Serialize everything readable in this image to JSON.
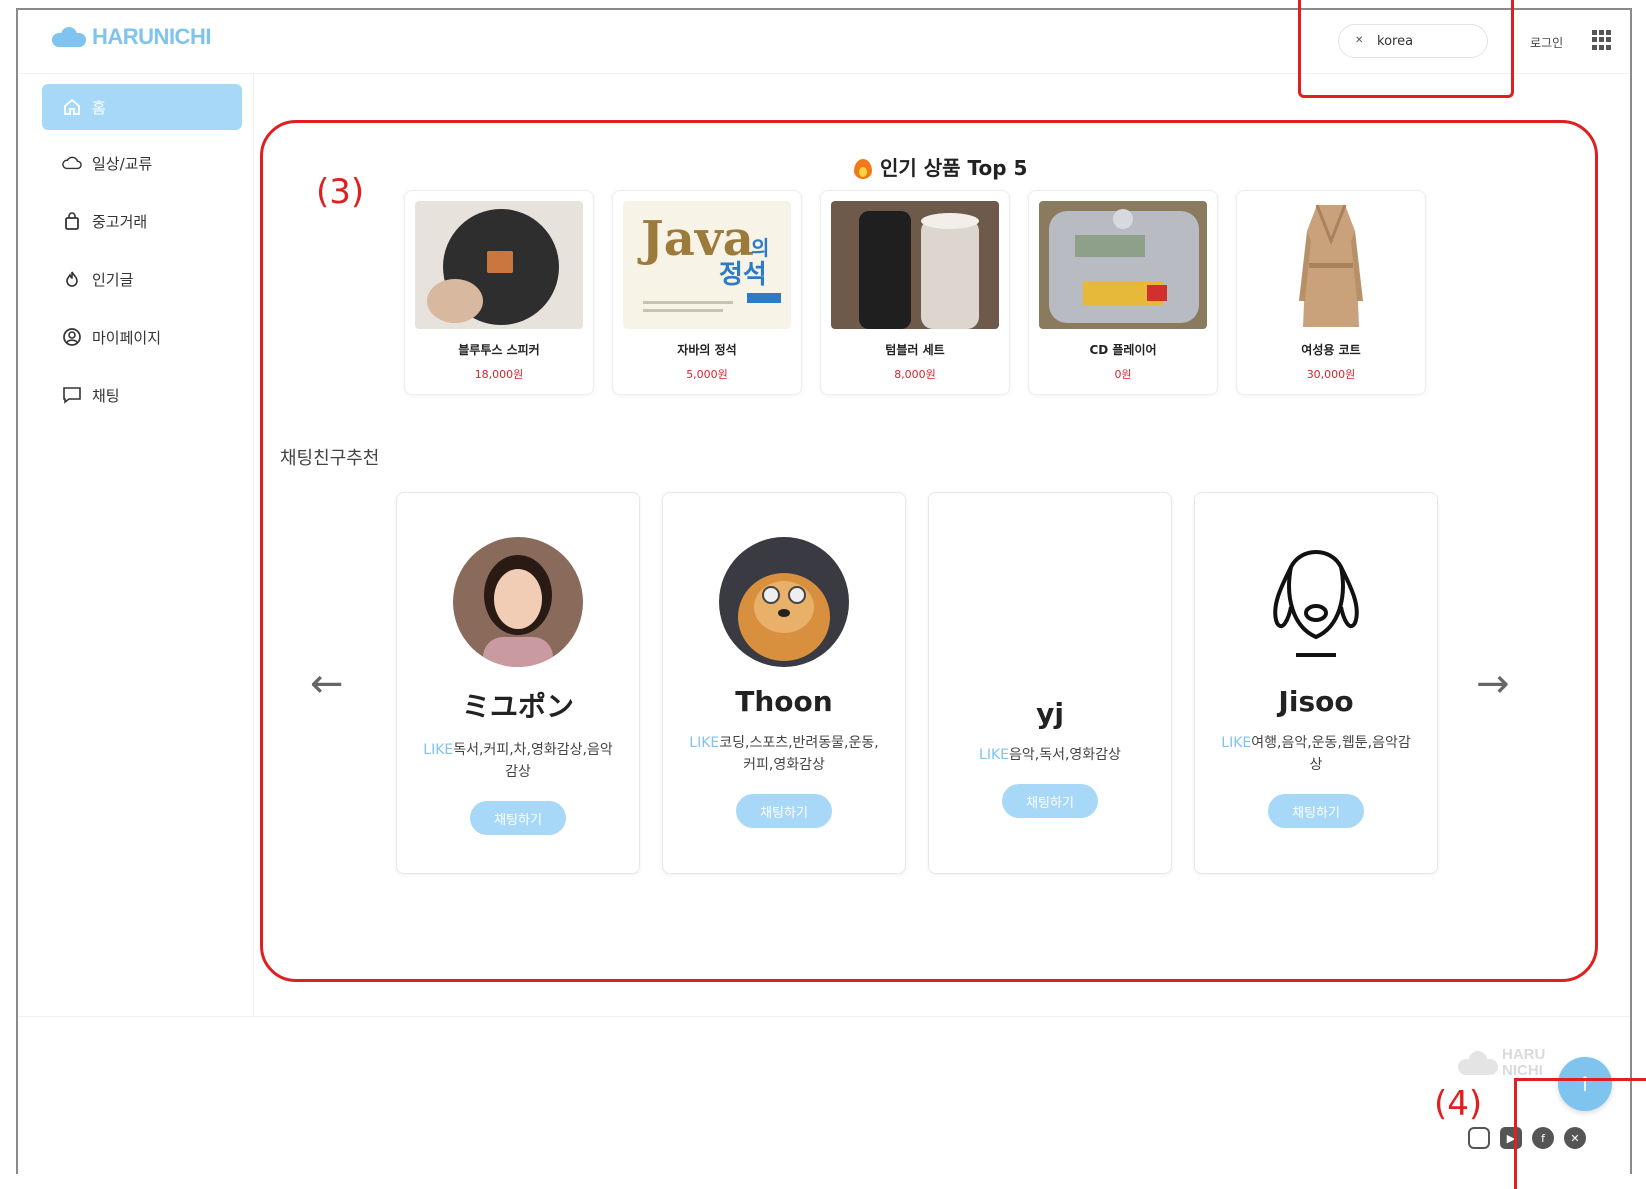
{
  "header": {
    "logo_text": "HARUNICHI",
    "language": "korea",
    "login_label": "로그인"
  },
  "sidebar": {
    "items": [
      {
        "label": "홈",
        "icon": "home-icon"
      },
      {
        "label": "일상/교류",
        "icon": "cloud-icon"
      },
      {
        "label": "중고거래",
        "icon": "bag-icon"
      },
      {
        "label": "인기글",
        "icon": "fire-icon"
      },
      {
        "label": "마이페이지",
        "icon": "user-circle-icon"
      },
      {
        "label": "채팅",
        "icon": "chat-icon"
      }
    ]
  },
  "popular": {
    "title": "인기 상품 Top 5",
    "products": [
      {
        "name": "블루투스 스피커",
        "price": "18,000원"
      },
      {
        "name": "자바의 정석",
        "price": "5,000원"
      },
      {
        "name": "텀블러 세트",
        "price": "8,000원"
      },
      {
        "name": "CD 플레이어",
        "price": "0원"
      },
      {
        "name": "여성용 코트",
        "price": "30,000원"
      }
    ]
  },
  "friends": {
    "title": "채팅친구추천",
    "like_prefix": "LIKE",
    "chat_button": "채팅하기",
    "items": [
      {
        "name": "ミユポン",
        "likes": "독서,커피,차,영화감상,음악감상"
      },
      {
        "name": "Thoon",
        "likes": "코딩,스포츠,반려동물,운동,커피,영화감상"
      },
      {
        "name": "yj",
        "likes": "음악,독서,영화감상"
      },
      {
        "name": "Jisoo",
        "likes": "여행,음악,운동,웹툰,음악감상"
      }
    ]
  },
  "footer": {
    "logo_text": "HARU NICHI",
    "social": [
      "instagram-icon",
      "youtube-icon",
      "facebook-icon",
      "x-icon"
    ]
  },
  "annotations": {
    "label_3": "(3)",
    "label_4": "(4)"
  },
  "colors": {
    "accent": "#7fc3ef",
    "active_nav": "#a8d8f8",
    "price": "#d9232e",
    "annotation": "#e02020"
  }
}
